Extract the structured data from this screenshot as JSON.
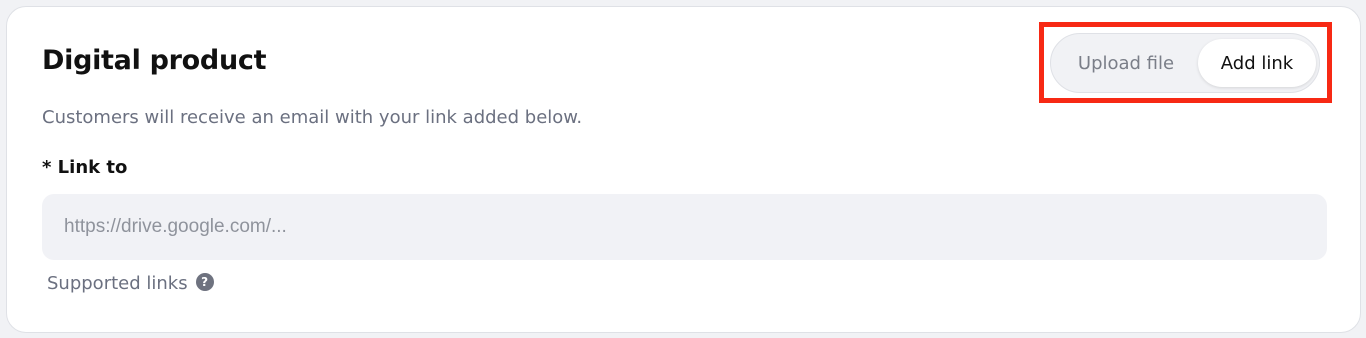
{
  "card": {
    "title": "Digital product",
    "description": "Customers will receive an email with your link added below.",
    "link_label": "* Link to",
    "link_input": {
      "value": "",
      "placeholder": "https://drive.google.com/..."
    },
    "supported_links": "Supported links",
    "help_icon_glyph": "?"
  },
  "mode_toggle": {
    "options": [
      {
        "label": "Upload file",
        "selected": false
      },
      {
        "label": "Add link",
        "selected": true
      }
    ]
  },
  "colors": {
    "highlight": "#f72914",
    "input_bg": "#f1f2f6",
    "muted_text": "#6b7080"
  }
}
